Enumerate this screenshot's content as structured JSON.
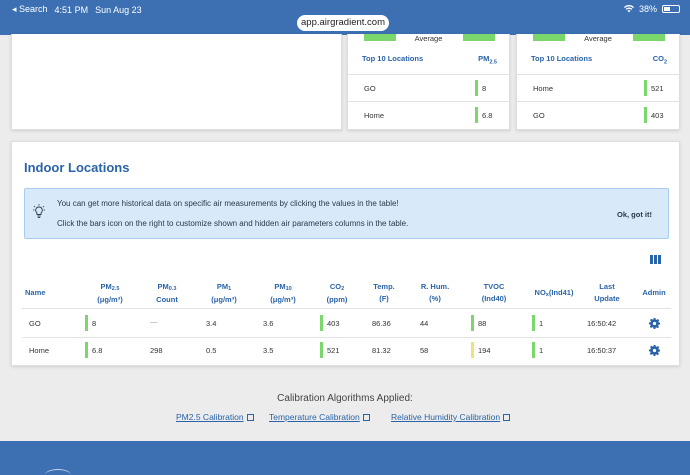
{
  "status_bar": {
    "back_label": "◂ Search",
    "time": "4:51 PM",
    "date": "Sun Aug 23",
    "battery": "38%",
    "url": "app.airgradient.com"
  },
  "top_cards": {
    "pm25": {
      "average_label": "Average",
      "header_location": "Top 10 Locations",
      "header_param": "PM",
      "header_param_sub": "2.5",
      "rows": [
        {
          "location": "GO",
          "value": "8"
        },
        {
          "location": "Home",
          "value": "6.8"
        }
      ]
    },
    "co2": {
      "average_label": "Average",
      "header_location": "Top 10 Locations",
      "header_param": "CO",
      "header_param_sub": "2",
      "rows": [
        {
          "location": "Home",
          "value": "521"
        },
        {
          "location": "GO",
          "value": "403"
        }
      ]
    }
  },
  "indoor": {
    "title": "Indoor Locations",
    "alert_line1": "You can get more historical data on specific air measurements by clicking the values in the table!",
    "alert_line2": "Click the bars icon on the right to customize shown and hidden air parameters columns in the table.",
    "alert_button": "Ok, got it!",
    "columns": {
      "name": "Name",
      "pm25": "PM",
      "pm25_sub": "2.5",
      "pm25_unit": "(μg/m³)",
      "pm03": "PM",
      "pm03_sub": "0.3",
      "pm03_unit": "Count",
      "pm1": "PM",
      "pm1_sub": "1",
      "pm1_unit": "(μg/m³)",
      "pm10": "PM",
      "pm10_sub": "10",
      "pm10_unit": "(μg/m³)",
      "co2": "CO",
      "co2_sub": "2",
      "co2_unit": "(ppm)",
      "temp": "Temp.",
      "temp_unit": "(F)",
      "rhum": "R. Hum.",
      "rhum_unit": "(%)",
      "tvoc": "TVOC",
      "tvoc_unit": "(Ind40)",
      "nox": "NO",
      "nox_sub": "x",
      "nox_suffix": "(Ind41)",
      "last": "Last",
      "last2": "Update",
      "admin": "Admin"
    },
    "rows": [
      {
        "name": "GO",
        "pm25": "8",
        "pm03": "—",
        "pm1": "3.4",
        "pm10": "3.6",
        "co2": "403",
        "temp": "86.36",
        "rhum": "44",
        "tvoc": "88",
        "nox": "1",
        "last": "16:50:42"
      },
      {
        "name": "Home",
        "pm25": "6.8",
        "pm03": "298",
        "pm1": "0.5",
        "pm10": "3.5",
        "co2": "521",
        "temp": "81.32",
        "rhum": "58",
        "tvoc": "194",
        "nox": "1",
        "last": "16:50:37"
      }
    ]
  },
  "calibration": {
    "title": "Calibration Algorithms Applied:",
    "links": [
      "PM2.5 Calibration",
      "Temperature Calibration",
      "Relative Humidity Calibration"
    ]
  },
  "colors": {
    "brand_blue": "#3c70b3",
    "heading_blue": "#2a64a8",
    "good_green": "#7bd66b",
    "moderate_yellow": "#f0e27a",
    "alert_bg": "#d8e9fa"
  }
}
